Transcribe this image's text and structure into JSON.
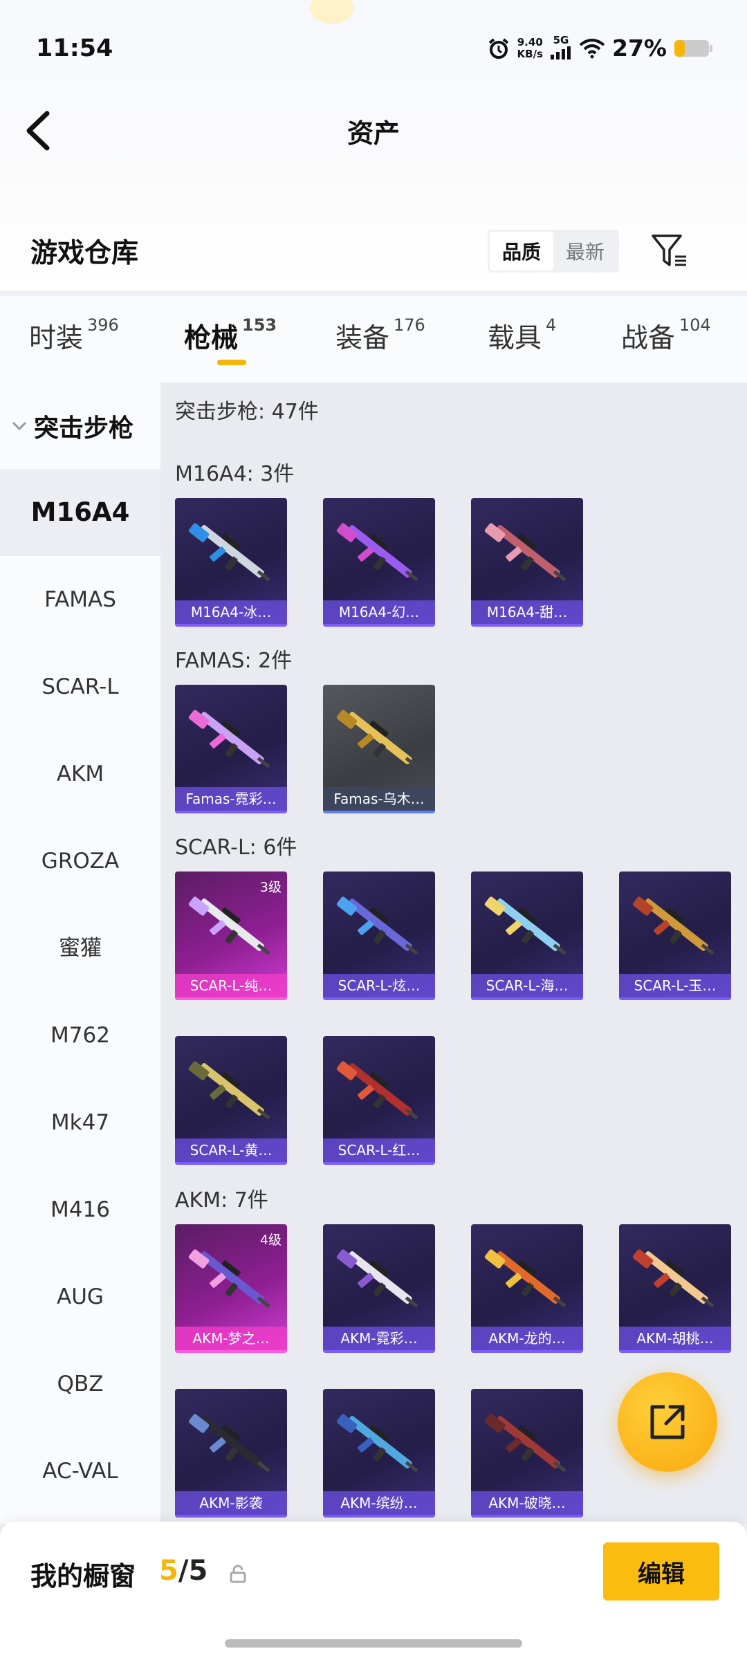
{
  "status_bar": {
    "time": "11:54",
    "net_speed_value": "9.40",
    "net_speed_unit": "KB/s",
    "network": "5G",
    "battery": "27%"
  },
  "header": {
    "title": "资产"
  },
  "warehouse": {
    "title": "游戏仓库",
    "sort_options": [
      "品质",
      "最新"
    ],
    "selected_sort": "品质"
  },
  "tabs": [
    {
      "label": "时装",
      "count": "396"
    },
    {
      "label": "枪械",
      "count": "153"
    },
    {
      "label": "装备",
      "count": "176"
    },
    {
      "label": "载具",
      "count": "4"
    },
    {
      "label": "战备",
      "count": "104"
    }
  ],
  "active_tab": "枪械",
  "sidebar": {
    "category": "突击步枪",
    "items": [
      "M16A4",
      "FAMAS",
      "SCAR-L",
      "AKM",
      "GROZA",
      "蜜獾",
      "M762",
      "Mk47",
      "M416",
      "AUG",
      "QBZ",
      "AC-VAL"
    ],
    "active": "M16A4"
  },
  "main": {
    "summary": "突击步枪: 47件",
    "sections": [
      {
        "heading": "M16A4: 3件",
        "items": [
          {
            "name": "M16A4-冰…"
          },
          {
            "name": "M16A4-幻…"
          },
          {
            "name": "M16A4-甜…"
          }
        ]
      },
      {
        "heading": "FAMAS: 2件",
        "items": [
          {
            "name": "Famas-霓彩…"
          },
          {
            "name": "Famas-乌木…"
          }
        ]
      },
      {
        "heading": "SCAR-L: 6件",
        "items": [
          {
            "name": "SCAR-L-纯…",
            "level": "3级"
          },
          {
            "name": "SCAR-L-炫…"
          },
          {
            "name": "SCAR-L-海…"
          },
          {
            "name": "SCAR-L-玉…"
          },
          {
            "name": "SCAR-L-黄…"
          },
          {
            "name": "SCAR-L-红…"
          }
        ]
      },
      {
        "heading": "AKM: 7件",
        "items": [
          {
            "name": "AKM-梦之…",
            "level": "4级"
          },
          {
            "name": "AKM-霓彩…"
          },
          {
            "name": "AKM-龙的…"
          },
          {
            "name": "AKM-胡桃…"
          },
          {
            "name": "AKM-影袭"
          },
          {
            "name": "AKM-缤纷…"
          },
          {
            "name": "AKM-破晓…"
          }
        ]
      }
    ]
  },
  "showcase": {
    "title": "我的橱窗",
    "count_current": "5",
    "count_max": "/5",
    "edit_label": "编辑"
  },
  "colors": {
    "accent": "#f5b50a",
    "legendary_pink": "#e23cd0",
    "epic_purple": "#2c2557"
  }
}
